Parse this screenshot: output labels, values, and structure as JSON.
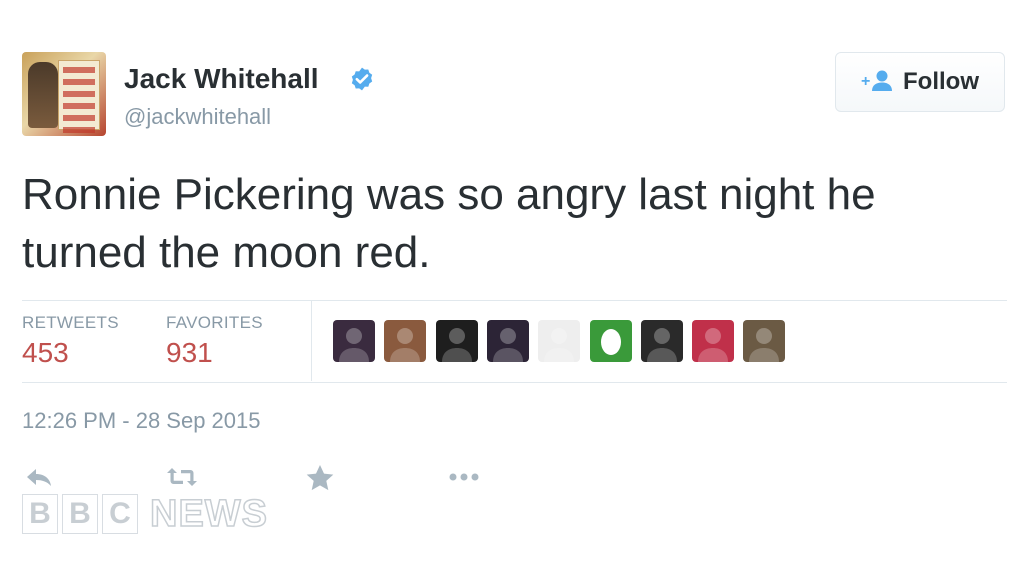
{
  "profile": {
    "name": "Jack Whitehall",
    "handle": "@jackwhitehall",
    "verified": true,
    "avatar_icon": "profile-avatar"
  },
  "follow": {
    "label": "Follow",
    "icon": "add-user-icon"
  },
  "tweet": {
    "text": "Ronnie Pickering was so angry last night he turned the moon red."
  },
  "stats": {
    "retweets_label": "RETWEETS",
    "retweets_value": "453",
    "favorites_label": "FAVORITES",
    "favorites_value": "931"
  },
  "favoriters": [
    {
      "icon": "user-avatar",
      "color": "#3a2b3f"
    },
    {
      "icon": "user-avatar",
      "color": "#8a5a3e"
    },
    {
      "icon": "user-avatar",
      "color": "#1e1e1e"
    },
    {
      "icon": "user-avatar",
      "color": "#2c2436"
    },
    {
      "icon": "user-avatar",
      "color": "#eeeeee"
    },
    {
      "icon": "egg-avatar",
      "color": "#3a9a3a"
    },
    {
      "icon": "user-avatar",
      "color": "#2a2a2a"
    },
    {
      "icon": "user-avatar",
      "color": "#c0304a"
    },
    {
      "icon": "user-avatar",
      "color": "#6b5a44"
    }
  ],
  "timestamp": "12:26 PM - 28 Sep 2015",
  "actions": [
    "reply-icon",
    "retweet-icon",
    "favorite-icon",
    "more-icon"
  ],
  "watermark": {
    "letters": [
      "B",
      "B",
      "C"
    ],
    "word": "NEWS"
  },
  "colors": {
    "stat_value": "#c0504d",
    "muted": "#8899a6",
    "verified": "#55acee",
    "text": "#292f33"
  }
}
